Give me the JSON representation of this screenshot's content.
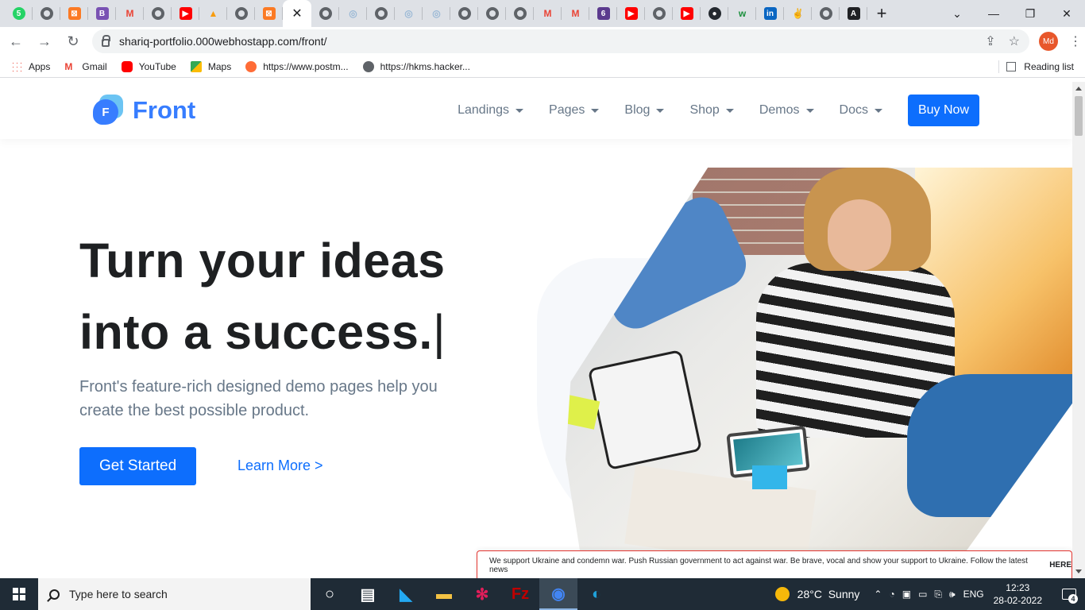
{
  "browser": {
    "tabs": [
      {
        "icon": "whatsapp-icon",
        "glyph": "5",
        "color": "#25d366",
        "shape": "circle"
      },
      {
        "icon": "globe-icon",
        "shape": "globe"
      },
      {
        "icon": "xampp-icon",
        "glyph": "⊠",
        "color": "#fb7a24",
        "shape": "square"
      },
      {
        "icon": "bootstrap-icon",
        "glyph": "B",
        "color": "#7952b3",
        "shape": "square"
      },
      {
        "icon": "gmail-icon",
        "glyph": "M",
        "color": "#ea4335",
        "shape": "gmail"
      },
      {
        "icon": "globe-icon",
        "shape": "globe"
      },
      {
        "icon": "youtube-icon",
        "glyph": "▶",
        "color": "#ff0000",
        "shape": "square"
      },
      {
        "icon": "phpmyadmin-icon",
        "glyph": "▲",
        "color": "#f89c0e",
        "shape": "gmail"
      },
      {
        "icon": "globe-icon",
        "shape": "globe"
      },
      {
        "icon": "xampp-icon",
        "glyph": "⊠",
        "color": "#fb7a24",
        "shape": "square"
      },
      {
        "icon": "close-icon",
        "shape": "active"
      },
      {
        "icon": "globe-icon",
        "shape": "globe"
      },
      {
        "icon": "loading-icon",
        "glyph": "◎",
        "color": "#9bb9d6",
        "shape": "gmail"
      },
      {
        "icon": "globe-icon",
        "shape": "globe"
      },
      {
        "icon": "loading-icon",
        "glyph": "◎",
        "color": "#9bb9d6",
        "shape": "gmail"
      },
      {
        "icon": "loading-icon",
        "glyph": "◎",
        "color": "#9bb9d6",
        "shape": "gmail"
      },
      {
        "icon": "globe-icon",
        "shape": "globe"
      },
      {
        "icon": "globe-icon",
        "shape": "globe"
      },
      {
        "icon": "globe-icon",
        "shape": "globe"
      },
      {
        "icon": "gmail-icon",
        "glyph": "M",
        "color": "#ea4335",
        "shape": "gmail"
      },
      {
        "icon": "gmail-icon",
        "glyph": "M",
        "color": "#ea4335",
        "shape": "gmail"
      },
      {
        "icon": "six-icon",
        "glyph": "6",
        "color": "#5b3a8e",
        "shape": "square"
      },
      {
        "icon": "youtube-icon",
        "glyph": "▶",
        "color": "#ff0000",
        "shape": "square"
      },
      {
        "icon": "globe-icon",
        "shape": "globe"
      },
      {
        "icon": "youtube-icon",
        "glyph": "▶",
        "color": "#ff0000",
        "shape": "square"
      },
      {
        "icon": "github-icon",
        "glyph": "●",
        "color": "#24292f",
        "shape": "circle"
      },
      {
        "icon": "w-icon",
        "glyph": "w",
        "color": "#1a8f3c",
        "shape": "gmail"
      },
      {
        "icon": "linkedin-icon",
        "glyph": "in",
        "color": "#0a66c2",
        "shape": "square"
      },
      {
        "icon": "peace-icon",
        "glyph": "✌",
        "color": "#444",
        "shape": "gmail"
      },
      {
        "icon": "globe-icon",
        "shape": "globe"
      },
      {
        "icon": "angular-icon",
        "glyph": "A",
        "color": "#202124",
        "shape": "square"
      }
    ],
    "url": "shariq-portfolio.000webhostapp.com/front/",
    "profile_initials": "Md",
    "bookmarks": [
      {
        "label": "Apps",
        "icon": "apps-grid-icon"
      },
      {
        "label": "Gmail",
        "icon": "gmail-icon"
      },
      {
        "label": "YouTube",
        "icon": "youtube-icon"
      },
      {
        "label": "Maps",
        "icon": "maps-icon"
      },
      {
        "label": "https://www.postm...",
        "icon": "postman-icon"
      },
      {
        "label": "https://hkms.hacker...",
        "icon": "globe-icon"
      }
    ],
    "reading_list": "Reading list"
  },
  "site": {
    "brand": "Front",
    "logo_letter": "F",
    "nav": [
      "Landings",
      "Pages",
      "Blog",
      "Shop",
      "Demos",
      "Docs"
    ],
    "buy_now": "Buy Now",
    "hero": {
      "title_line1": "Turn your ideas",
      "title_line2": "into a success.",
      "cursor": "|",
      "subtitle": "Front's feature-rich designed demo pages help you create the best possible product.",
      "cta_primary": "Get Started",
      "cta_secondary": "Learn More >"
    },
    "notice": {
      "text": "We support Ukraine and condemn war. Push Russian government to act against war. Be brave, vocal and show your support to Ukraine. Follow the latest news",
      "link": "HERE"
    },
    "colors": {
      "primary": "#0d6efd",
      "brand": "#377dff",
      "heading": "#1e2022",
      "muted": "#677788"
    }
  },
  "taskbar": {
    "search_placeholder": "Type here to search",
    "apps": [
      {
        "name": "task-view-icon",
        "color": "#ffffff",
        "glyph": "○"
      },
      {
        "name": "widgets-icon",
        "color": "#ffffff",
        "glyph": "▤"
      },
      {
        "name": "vscode-icon",
        "color": "#23a9f2",
        "glyph": "◣"
      },
      {
        "name": "file-explorer-icon",
        "color": "#f3c244",
        "glyph": "▬"
      },
      {
        "name": "slack-icon",
        "color": "#e01e5a",
        "glyph": "✻"
      },
      {
        "name": "filezilla-icon",
        "color": "#bf0000",
        "glyph": "Fz"
      },
      {
        "name": "chrome-icon",
        "color": "#4285f4",
        "glyph": "◉"
      },
      {
        "name": "edge-icon",
        "color": "#1fa0d8",
        "glyph": "◐"
      }
    ],
    "weather_temp": "28°C",
    "weather_desc": "Sunny",
    "language": "ENG",
    "time": "12:23",
    "date": "28-02-2022",
    "notification_count": "4"
  }
}
